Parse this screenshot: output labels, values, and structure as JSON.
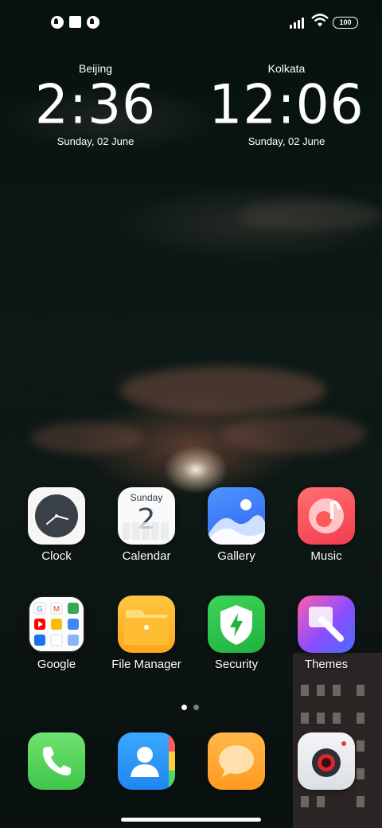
{
  "status_bar": {
    "battery": "100",
    "icons": [
      "notification-icon",
      "notification-icon",
      "square-icon",
      "signal-icon",
      "wifi-icon",
      "battery-icon"
    ]
  },
  "clocks": [
    {
      "city": "Beijing",
      "time": "2:36",
      "date": "Sunday, 02 June"
    },
    {
      "city": "Kolkata",
      "time": "12:06",
      "date": "Sunday, 02 June"
    }
  ],
  "apps": [
    {
      "label": "Clock"
    },
    {
      "label": "Calendar",
      "day_name": "Sunday",
      "day_num": "2"
    },
    {
      "label": "Gallery"
    },
    {
      "label": "Music"
    },
    {
      "label": "Google"
    },
    {
      "label": "File Manager"
    },
    {
      "label": "Security"
    },
    {
      "label": "Themes"
    }
  ],
  "dock": [
    {
      "name": "phone"
    },
    {
      "name": "contacts"
    },
    {
      "name": "messages"
    },
    {
      "name": "camera"
    }
  ],
  "page_indicator": {
    "total": 2,
    "current": 1
  },
  "colors": {
    "accent_music": "#ff5a5a",
    "security_green": "#2fc34c",
    "files_yellow": "#ffb12a",
    "gallery_blue": "#3a7bff"
  }
}
